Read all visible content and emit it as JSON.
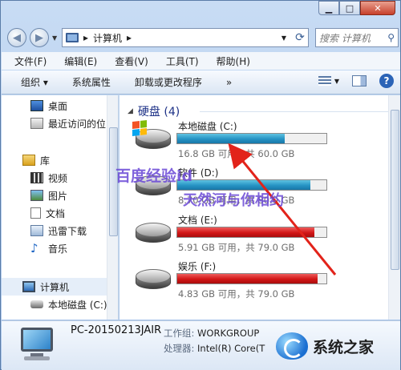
{
  "window": {
    "minimize_glyph": "▁",
    "maximize_glyph": "□",
    "close_glyph": "✕"
  },
  "address_bar": {
    "breadcrumb_root_icon": "computer-icon",
    "breadcrumb_separator": "▸",
    "breadcrumb": "计算机",
    "search_placeholder": "搜索 计算机"
  },
  "menu": [
    "文件(F)",
    "编辑(E)",
    "查看(V)",
    "工具(T)",
    "帮助(H)"
  ],
  "toolbar": {
    "organize": "组织 ▾",
    "system_properties": "系统属性",
    "uninstall": "卸载或更改程序",
    "more": "»"
  },
  "nav": {
    "items": [
      {
        "label": "桌面",
        "icon": "desktop-icon"
      },
      {
        "label": "最近访问的位",
        "icon": "recent-places-icon"
      },
      {
        "label": "库",
        "icon": "libraries-icon"
      },
      {
        "label": "视频",
        "icon": "video-icon"
      },
      {
        "label": "图片",
        "icon": "pictures-icon"
      },
      {
        "label": "文档",
        "icon": "documents-icon"
      },
      {
        "label": "迅雷下载",
        "icon": "download-folder-icon"
      },
      {
        "label": "音乐",
        "icon": "music-icon"
      },
      {
        "label": "计算机",
        "icon": "computer-icon"
      },
      {
        "label": "本地磁盘 (C:)",
        "icon": "local-disk-icon"
      }
    ]
  },
  "content": {
    "group_title": "硬盘 (4)",
    "drives": [
      {
        "name": "本地磁盘 (C:)",
        "info": "16.8 GB 可用，共 60.0 GB",
        "used_fraction": 0.72,
        "color": "blue",
        "system": true
      },
      {
        "name": "软件 (D:)",
        "info": "8.70 GB 可用，共 80.0 GB",
        "used_fraction": 0.89,
        "color": "blue",
        "system": false
      },
      {
        "name": "文档 (E:)",
        "info": "5.91 GB 可用，共 79.0 GB",
        "used_fraction": 0.92,
        "color": "red",
        "system": false
      },
      {
        "name": "娱乐 (F:)",
        "info": "4.83 GB 可用，共 79.0 GB",
        "used_fraction": 0.94,
        "color": "red",
        "system": false
      }
    ]
  },
  "status": {
    "computer_name": "PC-20150213JAIR",
    "workgroup_label": "工作组:",
    "workgroup": "WORKGROUP",
    "processor_label": "处理器:",
    "processor": "Intel(R) Core(T"
  },
  "overlay": {
    "watermark1": "百度经验id",
    "watermark2": "天然河与你相约",
    "corner_logo": "系统之家",
    "arrow_color": "#e2231a"
  }
}
